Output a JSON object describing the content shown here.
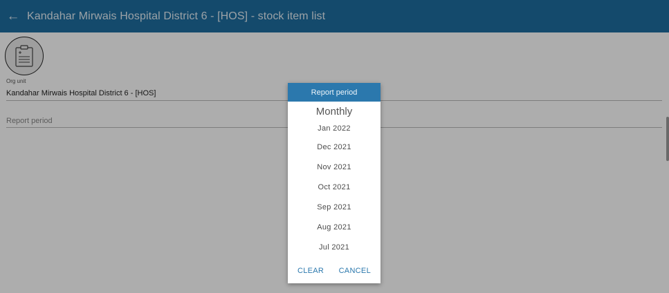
{
  "header": {
    "back_icon": "arrow-left-icon",
    "title": "Kandahar Mirwais Hospital District 6 -  [HOS] - stock item list"
  },
  "org_unit": {
    "icon": "clipboard-icon",
    "label": "Org unit",
    "value": "Kandahar Mirwais Hospital District 6 -  [HOS]"
  },
  "report_period_field": {
    "placeholder": "Report period"
  },
  "dialog": {
    "title": "Report period",
    "period_type": "Monthly",
    "periods": [
      "Jan 2022",
      "Dec 2021",
      "Nov 2021",
      "Oct 2021",
      "Sep 2021",
      "Aug 2021",
      "Jul 2021"
    ],
    "clear_label": "CLEAR",
    "cancel_label": "CANCEL"
  },
  "colors": {
    "app_bar": "#1e6d9f",
    "dialog_header": "#2b78ad",
    "accent": "#2b78ad"
  }
}
